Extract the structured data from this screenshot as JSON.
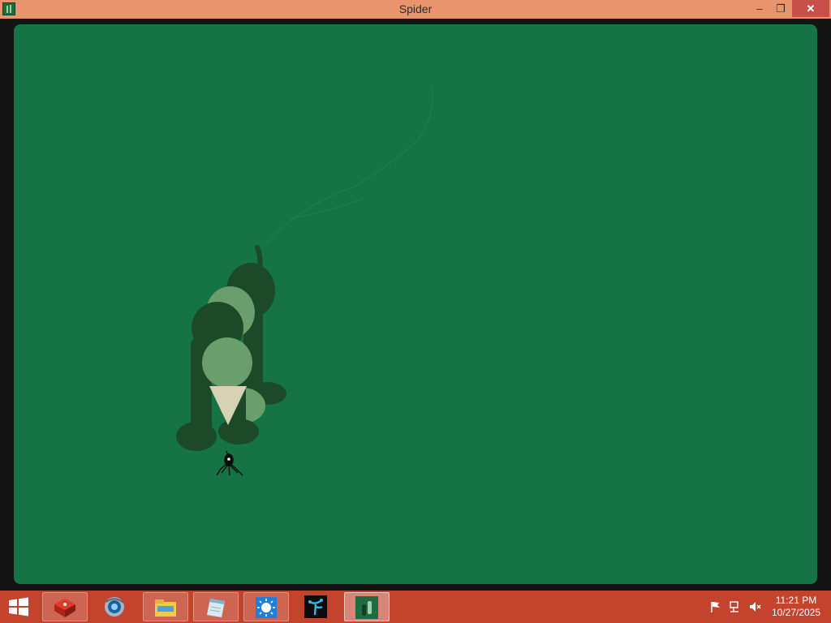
{
  "window": {
    "title": "Spider",
    "minimize_glyph": "–",
    "maximize_glyph": "❐",
    "close_glyph": "✕",
    "app_icon": "spider-app-icon"
  },
  "colors": {
    "titlebar": "#e8946c",
    "canvas": "#157345",
    "taskbar": "#c4432d",
    "close_button": "#c7504a"
  },
  "scene": {
    "creature": "dark-green-elephant",
    "player": "spider-sprite"
  },
  "taskbar": {
    "items": [
      {
        "name": "app-3d-box",
        "icon": "red-3d-box-icon"
      },
      {
        "name": "app-browser",
        "icon": "globe-browser-icon"
      },
      {
        "name": "app-file-explorer",
        "icon": "folder-icon"
      },
      {
        "name": "app-notepad",
        "icon": "notepad-icon"
      },
      {
        "name": "app-sun",
        "icon": "sun-icon"
      },
      {
        "name": "app-tree",
        "icon": "blue-tree-icon"
      },
      {
        "name": "app-spider",
        "icon": "spider-app-icon"
      }
    ],
    "tray": {
      "flag_icon": "action-center-flag-icon",
      "network_icon": "network-icon",
      "volume_icon": "volume-muted-icon"
    },
    "clock": {
      "time": "11:21 PM",
      "date": "10/27/2025"
    }
  }
}
